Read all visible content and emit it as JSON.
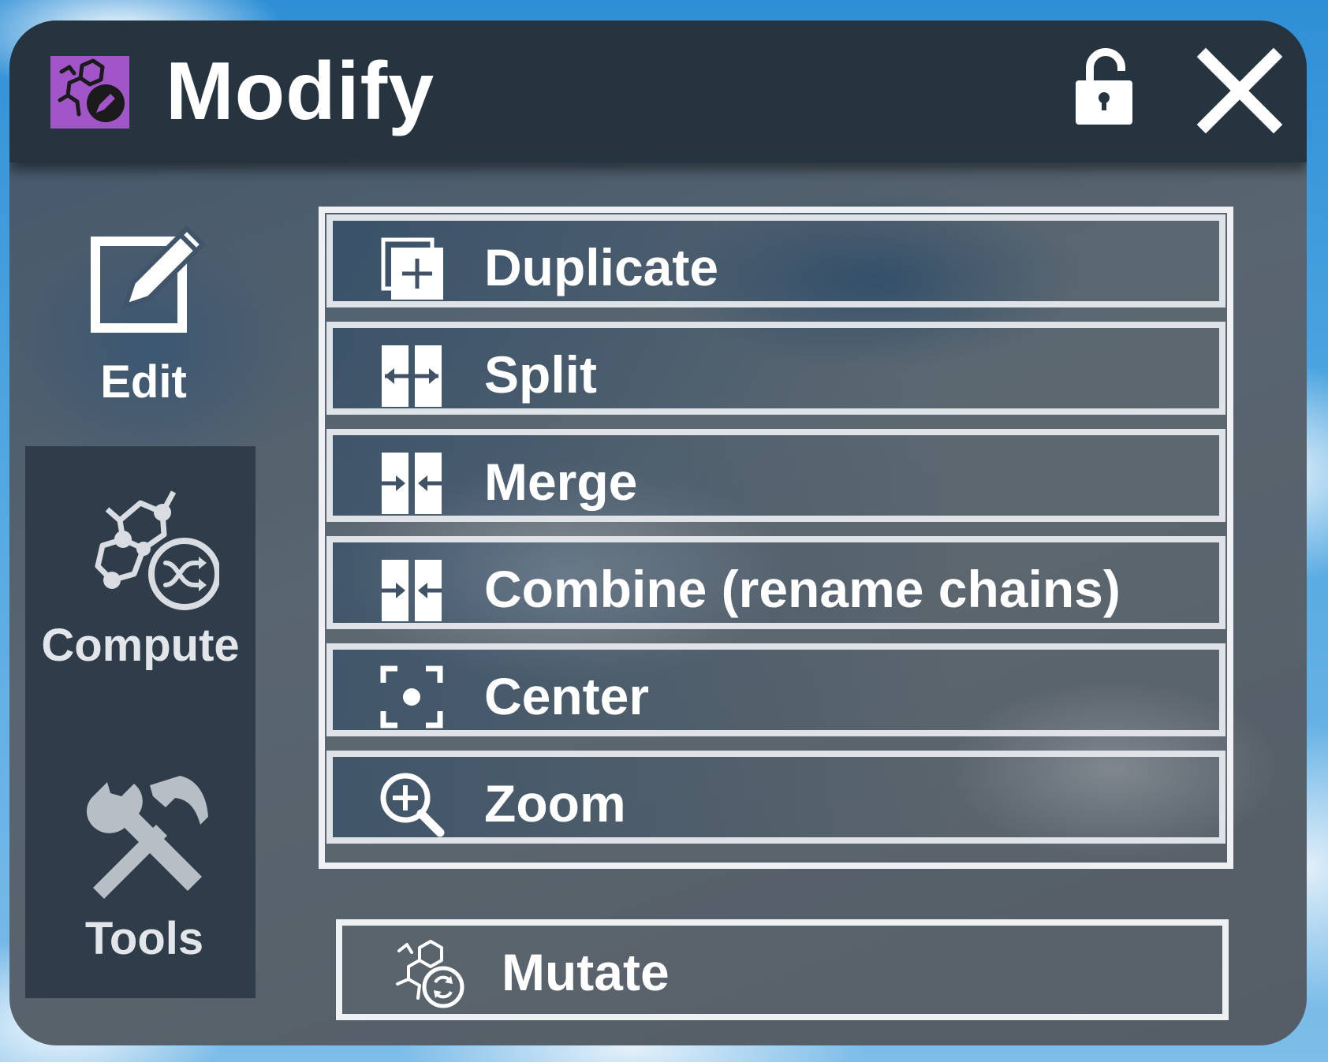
{
  "window": {
    "title": "Modify",
    "icon": "molecule-edit-icon",
    "lock_icon": "unlock-icon",
    "close_icon": "close-icon",
    "accent": "#a155c8"
  },
  "sidebar": {
    "items": [
      {
        "label": "Edit",
        "icon": "edit-icon",
        "active": true
      },
      {
        "label": "Compute",
        "icon": "molecule-shuffle-icon",
        "active": false
      },
      {
        "label": "Tools",
        "icon": "tools-icon",
        "active": false
      }
    ]
  },
  "menu": {
    "items": [
      {
        "label": "Duplicate",
        "icon": "duplicate-icon"
      },
      {
        "label": "Split",
        "icon": "split-icon"
      },
      {
        "label": "Merge",
        "icon": "merge-icon"
      },
      {
        "label": "Combine (rename chains)",
        "icon": "combine-icon"
      },
      {
        "label": "Center",
        "icon": "center-focus-icon"
      },
      {
        "label": "Zoom",
        "icon": "zoom-in-icon"
      }
    ],
    "mutate": {
      "label": "Mutate",
      "icon": "molecule-refresh-icon"
    }
  }
}
